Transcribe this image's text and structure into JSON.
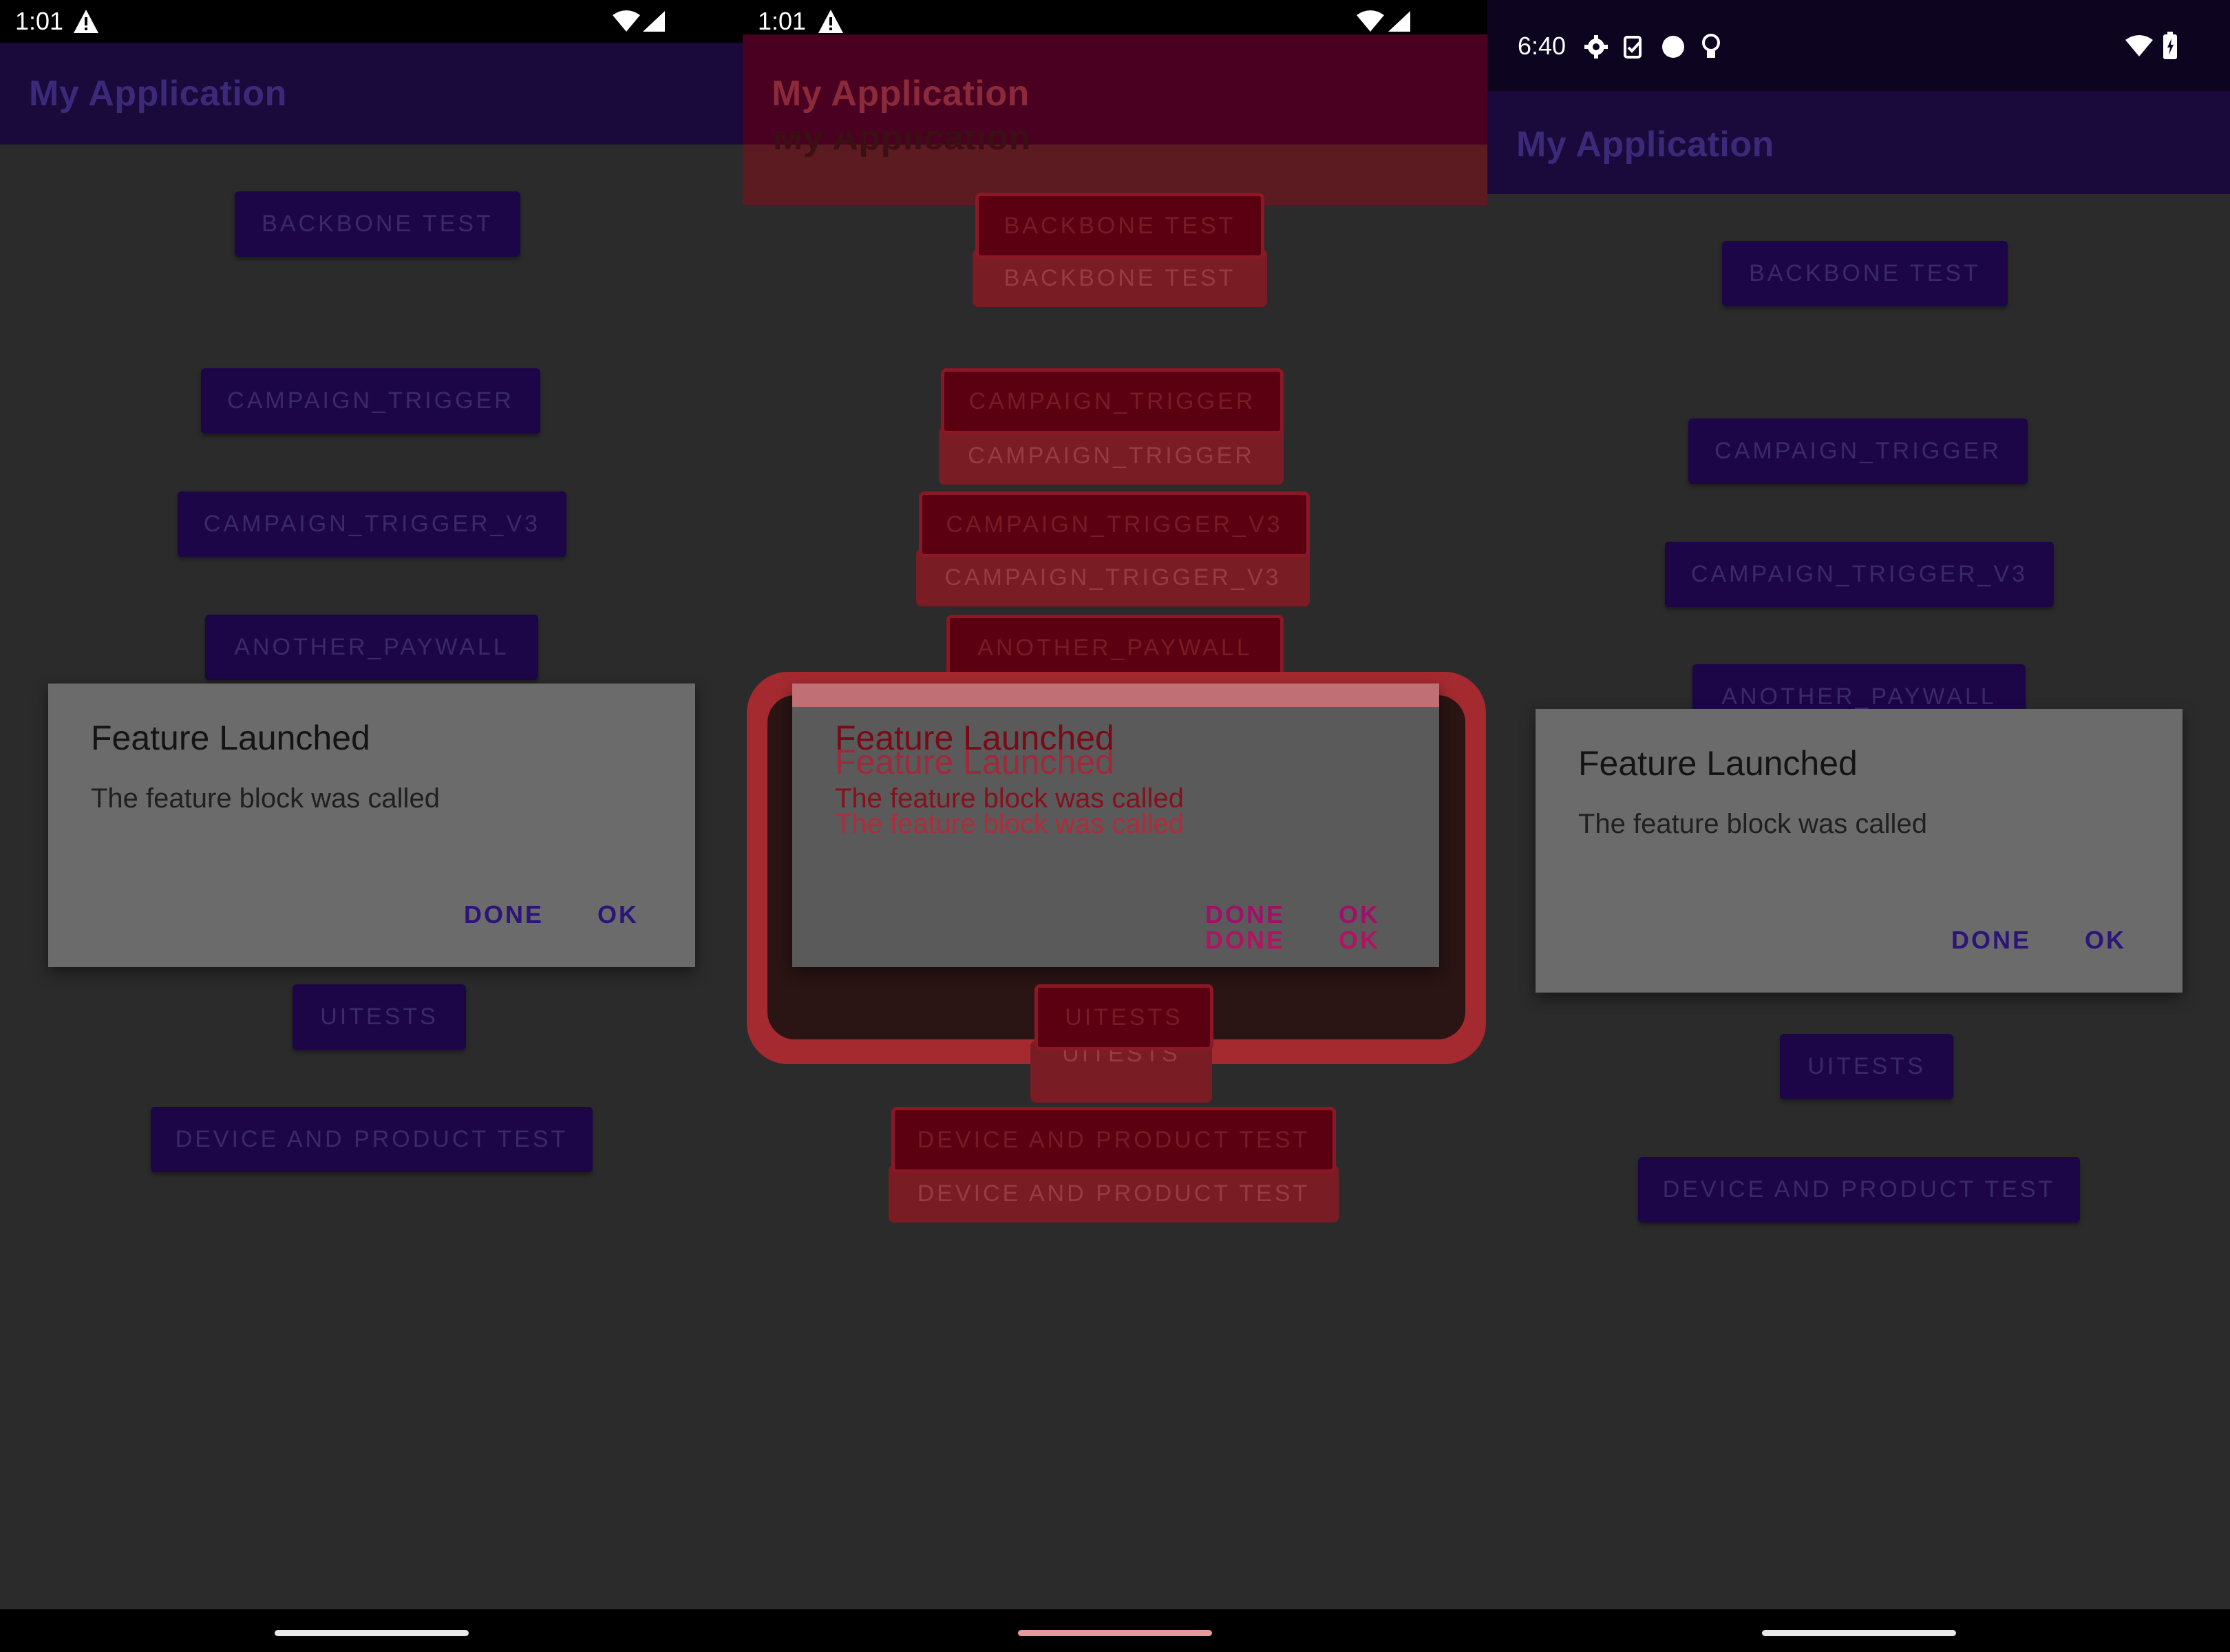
{
  "app": {
    "title": "My Application"
  },
  "panels": {
    "left": {
      "status": {
        "time": "1:01"
      }
    },
    "middle": {
      "status": {
        "time": "1:01"
      },
      "appbar_ghost": "My Application"
    },
    "right": {
      "status": {
        "time": "6:40"
      }
    }
  },
  "buttons": {
    "backbone": "BACKBONE TEST",
    "campaign": "CAMPAIGN_TRIGGER",
    "campaign_v3": "CAMPAIGN_TRIGGER_V3",
    "paywall": "ANOTHER_PAYWALL",
    "uitests": "UITESTS",
    "device": "DEVICE AND PRODUCT TEST"
  },
  "dialog": {
    "title": "Feature Launched",
    "message": "The feature block was called",
    "done_label": "DONE",
    "ok_label": "OK"
  },
  "colors": {
    "appbar": "#1a0a3b",
    "button_bg": "#1c0647",
    "dialog_bg": "#6b6b6b",
    "dialog_action": "#2c1478",
    "diff_highlight": "#c0292f"
  },
  "icons": {
    "status_left": [
      "warning-icon",
      "wifi-icon",
      "signal-icon"
    ],
    "status_right": [
      "gear-icon",
      "clipboard-check-icon",
      "circle-dot-icon",
      "lightbulb-icon",
      "wifi-icon",
      "battery-icon"
    ]
  }
}
